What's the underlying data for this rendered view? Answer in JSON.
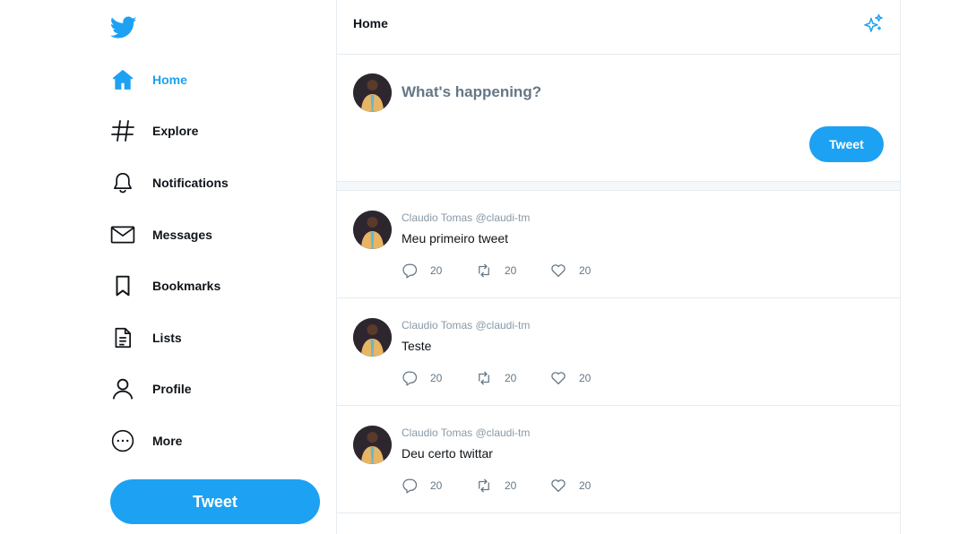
{
  "colors": {
    "accent": "#1da1f2",
    "muted": "#657786",
    "border": "#e6ecf0"
  },
  "sidebar": {
    "logo_icon": "twitter-bird-icon",
    "items": [
      {
        "label": "Home",
        "icon": "home-icon",
        "active": true
      },
      {
        "label": "Explore",
        "icon": "hashtag-icon"
      },
      {
        "label": "Notifications",
        "icon": "bell-icon"
      },
      {
        "label": "Messages",
        "icon": "envelope-icon"
      },
      {
        "label": "Bookmarks",
        "icon": "bookmark-icon"
      },
      {
        "label": "Lists",
        "icon": "list-document-icon"
      },
      {
        "label": "Profile",
        "icon": "person-icon"
      },
      {
        "label": "More",
        "icon": "more-circle-icon"
      }
    ],
    "tweet_label": "Tweet"
  },
  "header": {
    "title": "Home",
    "icon": "sparkle-icon"
  },
  "composer": {
    "placeholder": "What's happening?",
    "tweet_label": "Tweet"
  },
  "tweets": [
    {
      "author": "Claudio Tomas @claudi-tm",
      "text": "Meu primeiro tweet",
      "replies": "20",
      "retweets": "20",
      "likes": "20"
    },
    {
      "author": "Claudio Tomas @claudi-tm",
      "text": "Teste",
      "replies": "20",
      "retweets": "20",
      "likes": "20"
    },
    {
      "author": "Claudio Tomas @claudi-tm",
      "text": "Deu certo twittar",
      "replies": "20",
      "retweets": "20",
      "likes": "20"
    }
  ]
}
